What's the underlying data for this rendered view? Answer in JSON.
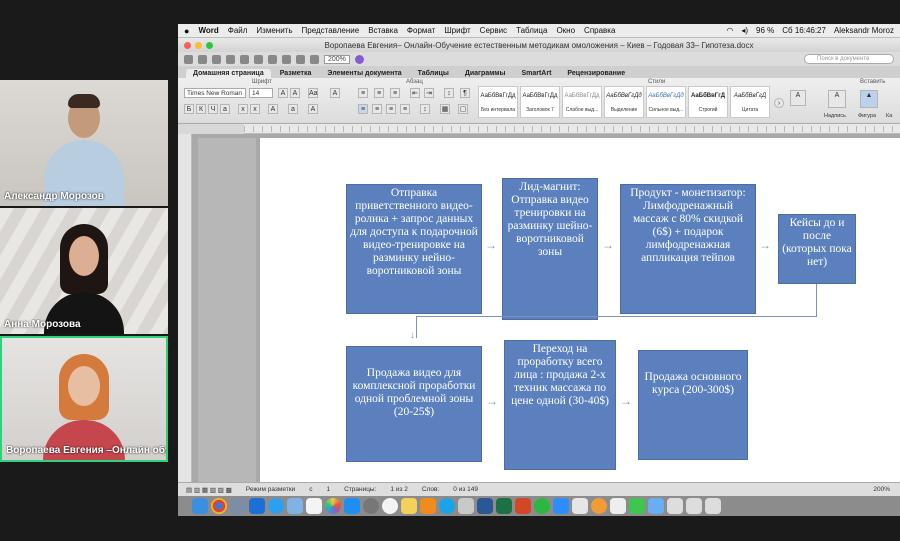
{
  "participants": [
    {
      "name": "Александр Морозов"
    },
    {
      "name": "Анна Морозова"
    },
    {
      "name": "Воропаева Евгения –Онлайн обуч..."
    }
  ],
  "menubar": {
    "apple": "",
    "app": "Word",
    "items": [
      "Файл",
      "Изменить",
      "Представление",
      "Вставка",
      "Формат",
      "Шрифт",
      "Сервис",
      "Таблица",
      "Окно",
      "Справка"
    ],
    "battery": "96 %",
    "clock": "Сб 16:46:27",
    "user": "Aleksandr Moroz"
  },
  "window": {
    "title": "Воропаева Евгения– Онлайн-Обучение естественным методикам омоложения – Киев – Годовая 33– Гипотеза.docx",
    "zoom": "200%",
    "search_placeholder": "Поиск в документе"
  },
  "ribbon_tabs": [
    "Домашняя страница",
    "Разметка",
    "Элементы документа",
    "Таблицы",
    "Диаграммы",
    "SmartArt",
    "Рецензирование"
  ],
  "ribbon": {
    "group_font": "Шрифт",
    "group_paragraph": "Абзац",
    "group_styles": "Стили",
    "group_insert": "Вставить",
    "font_name": "Times New Roman",
    "font_size": "14",
    "styles": [
      {
        "sample": "АаБбВвГгДд",
        "label": "Без интервала"
      },
      {
        "sample": "АаБбВвГгДд",
        "label": "Заголовок 7"
      },
      {
        "sample": "АаБбВвГгДд",
        "label": "Слабое выд..."
      },
      {
        "sample": "АаБбВвГгДд",
        "label": "Выделение"
      },
      {
        "sample": "АаБбВвГгДд",
        "label": "Сильное выд..."
      },
      {
        "sample": "АаБбВвГгД",
        "label": "Строгий"
      },
      {
        "sample": "АаБбВвГгД",
        "label": "Цитата"
      }
    ],
    "insert_items": [
      "Надпись",
      "Фигура",
      "Ка"
    ]
  },
  "flow": {
    "row1": [
      "Отправка приветственного видео-ролика + запрос данных для доступа к подарочной видео-тренировке на разминку нейно-воротниковой зоны",
      "Лид-магнит: Отправка видео тренировки на разминку шейно-воротниковой зоны",
      "Продукт - монетизатор: Лимфодренажный массаж с 80% скидкой (6$) + подарок лимфодренажная аппликация тейпов",
      "Кейсы до и после (которых пока нет)"
    ],
    "row2": [
      "Продажа видео для комплексной проработки одной проблемной зоны (20-25$)",
      "Переход на проработку всего лица : продажа 2-х техник массажа по цене одной (30-40$)",
      "Продажа основного курса (200-300$)"
    ]
  },
  "status": {
    "view": "Режим разметки",
    "section_label": "с",
    "section": "1",
    "pages_label": "Страницы:",
    "pages": "1 из 2",
    "words_label": "Слов:",
    "words": "0 из 149",
    "zoom": "200%"
  }
}
